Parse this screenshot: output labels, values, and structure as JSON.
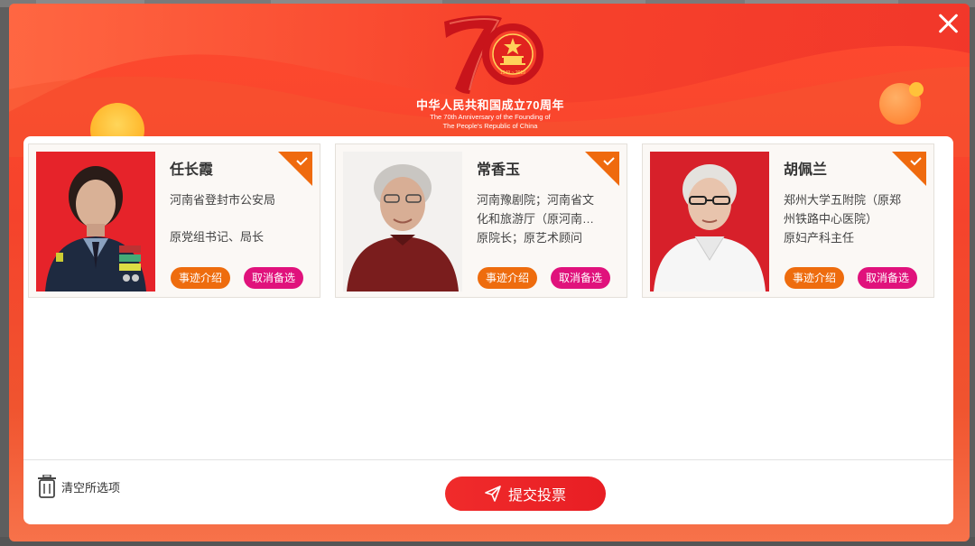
{
  "modal": {
    "logo": {
      "number": "70",
      "years": "1949 ~ 2019",
      "title_cn": "中华人民共和国成立70周年",
      "title_en_1": "The 70th Anniversary of the Founding of",
      "title_en_2": "The People's Republic of China"
    },
    "close_icon": "close-icon"
  },
  "candidates": [
    {
      "name": "任长霞",
      "lines": [
        "河南省登封市公安局",
        "",
        "原党组书记、局长"
      ],
      "detail_label": "事迹介绍",
      "cancel_label": "取消备选",
      "selected": true
    },
    {
      "name": "常香玉",
      "lines": [
        "河南豫剧院；河南省文",
        "化和旅游厅（原河南…",
        "原院长；原艺术顾问"
      ],
      "detail_label": "事迹介绍",
      "cancel_label": "取消备选",
      "selected": true
    },
    {
      "name": "胡佩兰",
      "lines": [
        "郑州大学五附院（原郑",
        "州铁路中心医院）",
        "原妇产科主任"
      ],
      "detail_label": "事迹介绍",
      "cancel_label": "取消备选",
      "selected": true
    }
  ],
  "footer": {
    "clear_label": "清空所选项",
    "submit_label": "提交投票"
  },
  "colors": {
    "modal_red": "#f5432c",
    "detail_orange": "#ee6c0e",
    "cancel_pink": "#e0127c",
    "submit_red": "#ec2529",
    "check_orange": "#ef6a0e"
  }
}
